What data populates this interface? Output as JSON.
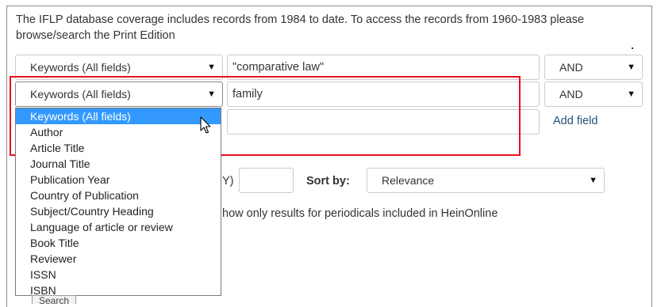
{
  "notice": "The IFLP database coverage includes records from 1984 to date. To access the records from 1960-1983 please browse/search the Print Edition",
  "rows": [
    {
      "field": "Keywords (All fields)",
      "value": "\"comparative law\"",
      "operator": "AND"
    },
    {
      "field": "Keywords (All fields)",
      "value": "family",
      "operator": "AND"
    },
    {
      "value": ""
    }
  ],
  "add_field_label": "Add field",
  "year": {
    "label_fragment": "Y)",
    "value": ""
  },
  "sort": {
    "label": "Sort by:",
    "value": "Relevance"
  },
  "heinonline_text": "how only results for periodicals included in HeinOnline",
  "dropdown_options": [
    "Keywords (All fields)",
    "Author",
    "Article Title",
    "Journal Title",
    "Publication Year",
    "Country of Publication",
    "Subject/Country Heading",
    "Language of article or review",
    "Book Title",
    "Reviewer",
    "ISSN",
    "ISBN"
  ],
  "selected_option_index": 0,
  "bottom_button_label": "Search",
  "colors": {
    "highlight": "#e8101a",
    "selection": "#3399ff",
    "link": "#23527c"
  }
}
